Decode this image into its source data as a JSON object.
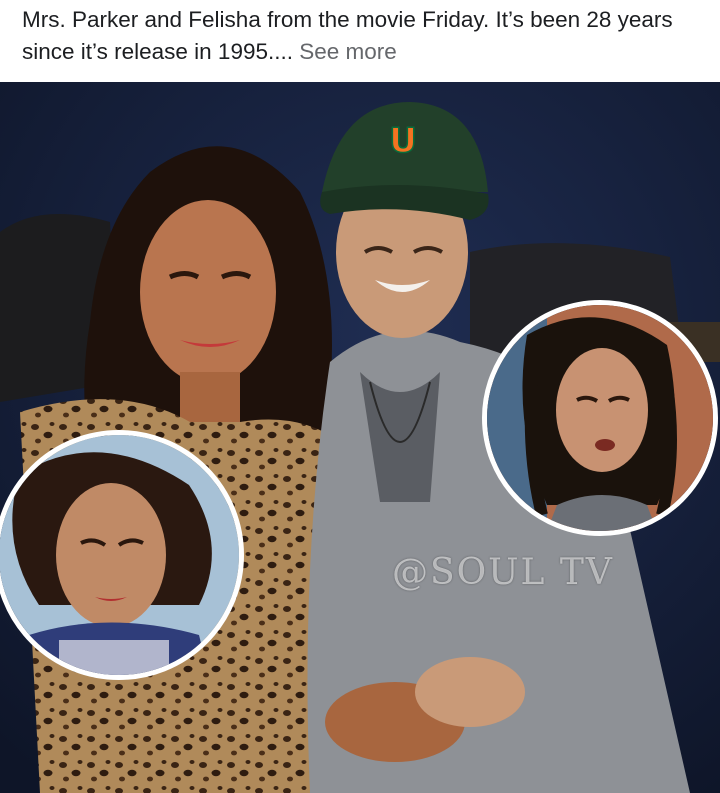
{
  "post": {
    "caption_text": "Mrs. Parker and Felisha from the movie Friday. It’s been 28 years since it’s release in 1995....",
    "see_more_label": "See more"
  },
  "photo": {
    "watermark": "@SOUL TV",
    "cap_logo": "U",
    "colors": {
      "background": "#15203a",
      "cap": "#22402a",
      "logo_orange": "#f47321",
      "logo_green": "#0a6d3a",
      "leopard": "#b08a5a",
      "hoodie": "#8e9196"
    }
  }
}
